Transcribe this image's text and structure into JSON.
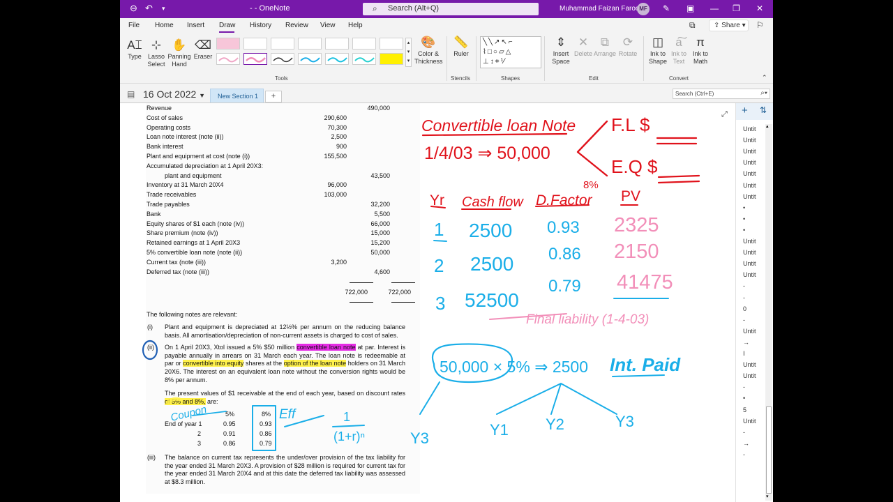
{
  "titlebar": {
    "app_title": "- - OneNote",
    "search_placeholder": "Search (Alt+Q)",
    "user_name": "Muhammad Faizan Farooq",
    "user_initials": "MF"
  },
  "menu": {
    "tabs": [
      "File",
      "Home",
      "Insert",
      "Draw",
      "History",
      "Review",
      "View",
      "Help"
    ],
    "active_tab": "Draw",
    "share_label": "Share"
  },
  "ribbon": {
    "type": "Type",
    "lasso_1": "Lasso",
    "lasso_2": "Select",
    "panning_1": "Panning",
    "panning_2": "Hand",
    "eraser": "Eraser",
    "color_1": "Color &",
    "color_2": "Thickness",
    "group_tools": "Tools",
    "ruler": "Ruler",
    "group_stencils": "Stencils",
    "group_shapes": "Shapes",
    "insert_1": "Insert",
    "insert_2": "Space",
    "delete": "Delete",
    "arrange": "Arrange",
    "rotate": "Rotate",
    "group_edit": "Edit",
    "inkshape_1": "Ink to",
    "inkshape_2": "Shape",
    "inktext_1": "Ink to",
    "inktext_2": "Text",
    "inkmath_1": "Ink to",
    "inkmath_2": "Math",
    "group_convert": "Convert"
  },
  "notebook": {
    "title": "16 Oct 2022",
    "section": "New Section 1",
    "add_section": "+",
    "search_placeholder": "Search (Ctrl+E)"
  },
  "trial_balance": [
    {
      "label": "Revenue",
      "c1": "",
      "c2": "490,000"
    },
    {
      "label": "Cost of sales",
      "c1": "290,600",
      "c2": ""
    },
    {
      "label": "Operating costs",
      "c1": "70,300",
      "c2": ""
    },
    {
      "label": "Loan note interest (note (ii))",
      "c1": "2,500",
      "c2": ""
    },
    {
      "label": "Bank interest",
      "c1": "900",
      "c2": ""
    },
    {
      "label": "Plant and equipment at cost (note (i))",
      "c1": "155,500",
      "c2": ""
    },
    {
      "label": "Accumulated depreciation at 1 April 20X3:",
      "c1": "",
      "c2": ""
    },
    {
      "label": "plant and equipment",
      "c1": "",
      "c2": "43,500",
      "indent": true
    },
    {
      "label": "Inventory at 31 March 20X4",
      "c1": "96,000",
      "c2": ""
    },
    {
      "label": "Trade receivables",
      "c1": "103,000",
      "c2": ""
    },
    {
      "label": "Trade payables",
      "c1": "",
      "c2": "32,200"
    },
    {
      "label": "Bank",
      "c1": "",
      "c2": "5,500"
    },
    {
      "label": "Equity shares of $1 each (note (iv))",
      "c1": "",
      "c2": "66,000"
    },
    {
      "label": "Share premium (note (iv))",
      "c1": "",
      "c2": "15,000"
    },
    {
      "label": "Retained earnings at 1 April 20X3",
      "c1": "",
      "c2": "15,200"
    },
    {
      "label": "5% convertible loan note (note (ii))",
      "c1": "",
      "c2": "50,000"
    },
    {
      "label": "Current tax (note (iii))",
      "c1": "3,200",
      "c2": ""
    },
    {
      "label": "Deferred tax (note (iii))",
      "c1": "",
      "c2": "4,600"
    }
  ],
  "totals": {
    "c1": "722,000",
    "c2": "722,000"
  },
  "notes": {
    "intro": "The following notes are relevant:",
    "n1_num": "(i)",
    "n1": "Plant and equipment is depreciated at 12½% per annum on the reducing balance basis. All amortisation/depreciation of non-current assets is charged to cost of sales.",
    "n2_num": "(ii)",
    "n2_a": "On 1 April 20X3, Xtol issued a 5% $50 million ",
    "n2_h1": "convertible loan note",
    "n2_b": " at par. Interest is payable annually in arrears on 31 March each year. The loan note is redeemable at par or ",
    "n2_h2": "convertible into equity",
    "n2_c": " shares at the ",
    "n2_h3": "option of the loan note",
    "n2_d": " holders on 31 March 20X6. The interest on an equivalent loan note without the conversion rights would be 8% per annum.",
    "pv_a": "The present values of $1 receivable at the end of each year, based on discount rates ",
    "pv_h": "of 5% and 8%,",
    "pv_b": " are:",
    "df_head5": "5%",
    "df_head8": "8%",
    "df_row1": "End of year 1",
    "df_row2": "2",
    "df_row3": "3",
    "df5": [
      "0.95",
      "0.91",
      "0.86"
    ],
    "df8": [
      "0.93",
      "0.86",
      "0.79"
    ],
    "n3_num": "(iii)",
    "n3": "The balance on current tax represents the under/over provision of the tax liability for the year ended 31 March 20X3. A provision of $28 million is required for current tax for the year ended 31 March 20X4 and at this date the deferred tax liability was assessed at $8.3 million."
  },
  "ink": {
    "title": "Convertible loan Note",
    "date_line": "1/4/03 ⇒ 50,000",
    "branch_1": "F.L $",
    "branch_2": "E.Q $",
    "col_yr": "Yr",
    "col_cf": "Cash flow",
    "col_df": "D.Factor",
    "col_df_rate": "8%",
    "col_pv": "PV",
    "years": [
      "1",
      "2",
      "3"
    ],
    "cashflows": [
      "2500",
      "2500",
      "52500"
    ],
    "factors": [
      "0.93",
      "0.86",
      "0.79"
    ],
    "pvs": [
      "2325",
      "2150",
      "41475"
    ],
    "fl_label": "Final liability (1-4-03)",
    "int_calc": "50,000 × 5% ⇒ 2500",
    "int_paid": "Int. Paid",
    "y_labels": [
      "Y1",
      "Y2",
      "Y3"
    ],
    "y3_left": "Y3",
    "coupon": "Coupon",
    "eff": "Eff",
    "formula_num": "1",
    "formula_den": "(1+r)ⁿ"
  },
  "pages": [
    "Untit",
    "Untit",
    "Untit",
    "Untit",
    "Untit",
    "Untit",
    "Untit",
    "•",
    "•",
    "•",
    "Untit",
    "Untit",
    "Untit",
    "Untit",
    "-",
    "-",
    "0",
    "-",
    "Untit",
    "→",
    "Ⅰ",
    "Untit",
    "Untit",
    "-",
    "•",
    "5",
    "Untit",
    "-",
    "→",
    "-"
  ],
  "colors": {
    "onenote_purple": "#7719aa",
    "ink_red": "#e0121b",
    "ink_blue": "#1aaee8",
    "ink_pink": "#f28fb9",
    "highlight_magenta": "#e52ce5",
    "highlight_yellow": "#fff14a"
  }
}
